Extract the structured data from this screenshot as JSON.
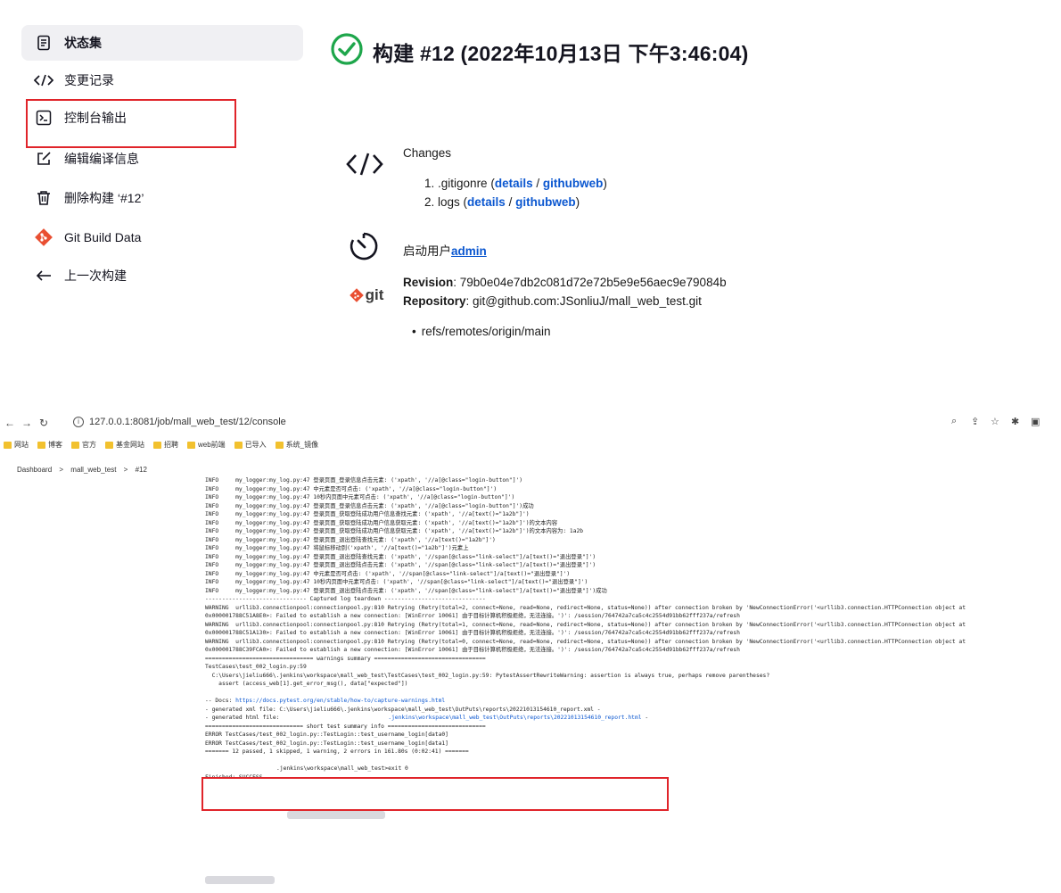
{
  "sidebar": {
    "items": [
      {
        "label": "状态集",
        "icon": "document-icon"
      },
      {
        "label": "变更记录",
        "icon": "code-icon"
      },
      {
        "label": "控制台输出",
        "icon": "terminal-icon"
      },
      {
        "label": "编辑编译信息",
        "icon": "edit-icon"
      },
      {
        "label": "删除构建 ‘#12’",
        "icon": "trash-icon"
      },
      {
        "label": "Git Build Data",
        "icon": "git-icon"
      },
      {
        "label": "上一次构建",
        "icon": "arrow-left-icon"
      }
    ]
  },
  "build": {
    "title": "构建 #12 (2022年10月13日 下午3:46:04)",
    "status_color": "#1ea64b"
  },
  "changes": {
    "heading": "Changes",
    "items": [
      {
        "num": "1.",
        "name": ".gitigonre",
        "details": "details",
        "sep": "/",
        "web": "githubweb"
      },
      {
        "num": "2.",
        "name": "logs",
        "details": "details",
        "sep": "/",
        "web": "githubweb"
      }
    ]
  },
  "started_by": {
    "label": "启动用户",
    "user": "admin"
  },
  "git": {
    "logo_text": "git",
    "revision_label": "Revision",
    "revision": ": 79b0e04e7db2c081d72e72b5e9e56aec9e79084b",
    "repository_label": "Repository",
    "repository": ": git@github.com:JSonliuJ/mall_web_test.git",
    "branch": "refs/remotes/origin/main"
  },
  "browser": {
    "url": "127.0.0.1:8081/job/mall_web_test/12/console",
    "bookmarks": [
      "网站",
      "博客",
      "官方",
      "基金网站",
      "招聘",
      "web前端",
      "已导入",
      "系统_镜像"
    ],
    "breadcrumb": [
      "Dashboard",
      ">",
      "mall_web_test",
      ">",
      "#12"
    ]
  },
  "console": {
    "lines": [
      "INFO     my_logger:my_log.py:47 登录页面_登录信息点击元素: ('xpath', '//a[@class=\"login-button\"]')",
      "INFO     my_logger:my_log.py:47 中元素是否可点击: ('xpath', '//a[@class=\"login-button\"]')",
      "INFO     my_logger:my_log.py:47 10秒内页面中元素可点击: ('xpath', '//a[@class=\"login-button\"]')",
      "INFO     my_logger:my_log.py:47 登录页面_登录信息点击元素: ('xpath', '//a[@class=\"login-button\"]')成功",
      "INFO     my_logger:my_log.py:47 登录页面_获取登陆成功用户信息查找元素: ('xpath', '//a[text()=\"1a2b\"]')",
      "INFO     my_logger:my_log.py:47 登录页面_获取登陆成功用户信息获取元素: ('xpath', '//a[text()=\"1a2b\"]')的文本内容",
      "INFO     my_logger:my_log.py:47 登录页面_获取登陆成功用户信息获取元素: ('xpath', '//a[text()=\"1a2b\"]')的文本内容为: 1a2b",
      "INFO     my_logger:my_log.py:47 登录页面_退出登陆查找元素: ('xpath', '//a[text()=\"1a2b\"]')",
      "INFO     my_logger:my_log.py:47 将鼠标移动到('xpath', '//a[text()=\"1a2b\"]')元素上",
      "INFO     my_logger:my_log.py:47 登录页面_退出登陆查找元素: ('xpath', '//span[@class=\"link-select\"]/a[text()=\"退出登录\"]')",
      "INFO     my_logger:my_log.py:47 登录页面_退出登陆点击元素: ('xpath', '//span[@class=\"link-select\"]/a[text()=\"退出登录\"]')",
      "INFO     my_logger:my_log.py:47 中元素是否可点击: ('xpath', '//span[@class=\"link-select\"]/a[text()=\"退出登录\"]')",
      "INFO     my_logger:my_log.py:47 10秒内页面中元素可点击: ('xpath', '//span[@class=\"link-select\"]/a[text()=\"退出登录\"]')",
      "INFO     my_logger:my_log.py:47 登录页面_退出登陆点击元素: ('xpath', '//span[@class=\"link-select\"]/a[text()=\"退出登录\"]')成功",
      "------------------------------ Captured log teardown ------------------------------",
      "WARNING  urllib3.connectionpool:connectionpool.py:810 Retrying (Retry(total=2, connect=None, read=None, redirect=None, status=None)) after connection broken by 'NewConnectionError('<urllib3.connection.HTTPConnection object at",
      "0x000001788C51A8E0>: Failed to establish a new connection: [WinError 10061] 由于目标计算机积极拒绝，无法连接。')': /session/764742a7ca5c4c2554d91bb62fff237a/refresh",
      "WARNING  urllib3.connectionpool:connectionpool.py:810 Retrying (Retry(total=1, connect=None, read=None, redirect=None, status=None)) after connection broken by 'NewConnectionError('<urllib3.connection.HTTPConnection object at",
      "0x000001788C51A130>: Failed to establish a new connection: [WinError 10061] 由于目标计算机积极拒绝，无法连接。')': /session/764742a7ca5c4c2554d91bb62fff237a/refresh",
      "WARNING  urllib3.connectionpool:connectionpool.py:810 Retrying (Retry(total=0, connect=None, read=None, redirect=None, status=None)) after connection broken by 'NewConnectionError('<urllib3.connection.HTTPConnection object at",
      "0x000001788C39FCA0>: Failed to establish a new connection: [WinError 10061] 由于目标计算机积极拒绝，无法连接。')': /session/764742a7ca5c4c2554d91bb62fff237a/refresh",
      "================================ warnings summary =================================",
      "TestCases\\test_002_login.py:59",
      "  C:\\Users\\jieliu666\\.jenkins\\workspace\\mall_web_test\\TestCases\\test_002_login.py:59: PytestAssertRewriteWarning: assertion is always true, perhaps remove parentheses?",
      "    assert (access_web[1].get_error_msg(), data[\"expected\"])",
      ""
    ],
    "docs_prefix": "-- Docs: ",
    "docs_url": "https://docs.pytest.org/en/stable/how-to/capture-warnings.html",
    "xml_line": "- generated xml file: C:\\Users\\jieliu666\\.jenkins\\workspace\\mall_web_test\\OutPuts\\reports\\20221013154610_report.xml -",
    "html_prefix": "- generated html file: ",
    "html_path": ".jenkins\\workspace\\mall_web_test\\OutPuts\\reports\\20221013154610_report.html",
    "html_suffix": " -",
    "tail_lines": [
      "============================= short test summary info =============================",
      "ERROR TestCases/test_002_login.py::TestLogin::test_username_login[data0]",
      "ERROR TestCases/test_002_login.py::TestLogin::test_username_login[data1]",
      "======= 12 passed, 1 skipped, 1 warning, 2 errors in 161.80s (0:02:41) ======="
    ],
    "exit_line": ".jenkins\\workspace\\mall_web_test>exit 0",
    "finished": "Finished: SUCCESS"
  }
}
